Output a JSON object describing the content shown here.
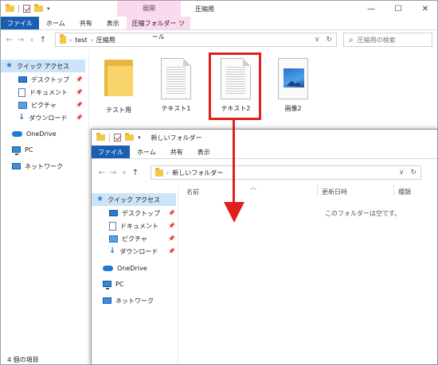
{
  "back_window": {
    "context_tab": "展開",
    "title": "圧縮用",
    "window_controls": [
      "minimize",
      "maximize",
      "close"
    ],
    "tabs": [
      "ファイル",
      "ホーム",
      "共有",
      "表示",
      "圧縮フォルダー ツール"
    ],
    "breadcrumb": [
      "test",
      "圧縮用"
    ],
    "search_placeholder": "圧縮用の検索",
    "nav": {
      "quick_access": "クイック アクセス",
      "desktop": "デスクトップ",
      "documents": "ドキュメント",
      "pictures": "ピクチャ",
      "downloads": "ダウンロード",
      "onedrive": "OneDrive",
      "pc": "PC",
      "network": "ネットワーク"
    },
    "files": [
      {
        "name": "テスト用",
        "type": "folder"
      },
      {
        "name": "テキスト1",
        "type": "text"
      },
      {
        "name": "テキスト2",
        "type": "text"
      },
      {
        "name": "画像2",
        "type": "image"
      }
    ],
    "status": "4 個の項目"
  },
  "front_window": {
    "title": "新しいフォルダー",
    "tabs": [
      "ファイル",
      "ホーム",
      "共有",
      "表示"
    ],
    "breadcrumb": [
      "新しいフォルダー"
    ],
    "nav": {
      "quick_access": "クイック アクセス",
      "desktop": "デスクトップ",
      "documents": "ドキュメント",
      "pictures": "ピクチャ",
      "downloads": "ダウンロード",
      "onedrive": "OneDrive",
      "pc": "PC",
      "network": "ネットワーク"
    },
    "columns": [
      "名前",
      "更新日時",
      "種類"
    ],
    "empty_message": "このフォルダーは空です。"
  },
  "colors": {
    "accent": "#1b5fb3",
    "context_tab": "#fbd9ee",
    "highlight_red": "#e0201c",
    "selected_nav": "#cce4f7"
  }
}
